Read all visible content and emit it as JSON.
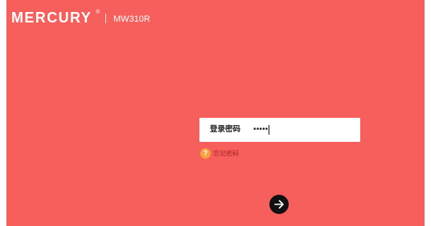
{
  "brand": {
    "logo_text": "MERCURY",
    "logo_mark": "®",
    "model": "MW310R"
  },
  "login": {
    "password_label": "登录密码",
    "password_mask": "•••••",
    "forgot_icon_glyph": "?",
    "forgot_label": "忘记密码",
    "submit_icon": "arrow-right-icon"
  },
  "colors": {
    "background": "#f65f5b",
    "page_edge": "#ffffff",
    "forgot_icon": "#f7a33b",
    "forgot_text": "#a51f1f",
    "submit_button": "#111111"
  }
}
